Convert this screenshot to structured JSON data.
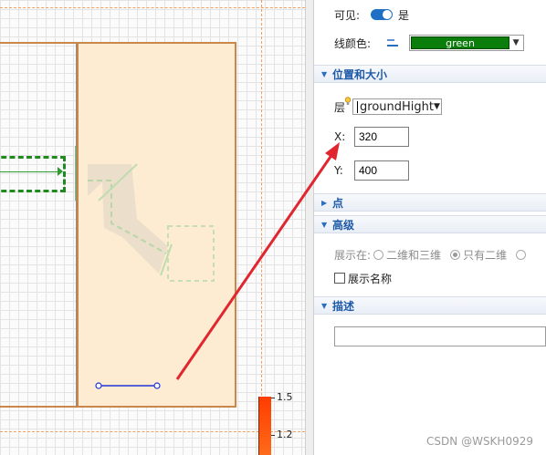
{
  "properties": {
    "visible": {
      "label": "可见:",
      "value": "是",
      "on": true
    },
    "line_color": {
      "label": "线颜色:",
      "value": "green",
      "color": "#0b7d0b"
    },
    "sections": {
      "position_size": {
        "title": "位置和大小",
        "expanded": true
      },
      "points": {
        "title": "点",
        "expanded": false
      },
      "advanced": {
        "title": "高级",
        "expanded": true
      },
      "description": {
        "title": "描述",
        "expanded": true
      }
    },
    "layer": {
      "label": "层",
      "value": "groundHight"
    },
    "x": {
      "label": "X:",
      "value": "320"
    },
    "y": {
      "label": "Y:",
      "value": "400"
    },
    "display_in": {
      "label": "展示在:",
      "options": [
        "二维和三维",
        "只有二维"
      ],
      "selected": "只有二维"
    },
    "show_name": {
      "label": "展示名称",
      "checked": false
    },
    "description_value": ""
  },
  "canvas": {
    "scale_labels": [
      "1.5",
      "1.2"
    ],
    "accent_colors": {
      "room_fill": "#fdebd2",
      "wall": "#c9874a",
      "annotation_arrow": "#e0262f",
      "selection_line": "#1f35d6"
    }
  },
  "watermark": "CSDN @WSKH0929"
}
